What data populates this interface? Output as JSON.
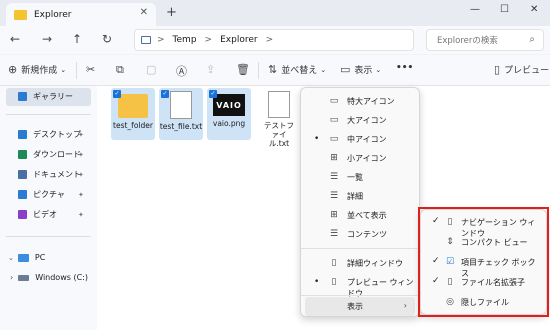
{
  "window": {
    "tab_title": "Explorer",
    "tab_close": "✕",
    "new_tab": "+",
    "minimize": "—",
    "maximize": "☐",
    "close": "✕"
  },
  "nav": {
    "back": "←",
    "forward": "→",
    "up": "↑",
    "refresh": "↻",
    "breadcrumb": [
      "Temp",
      "Explorer"
    ],
    "separator": ">",
    "search_placeholder": "Explorerの検索"
  },
  "toolbar": {
    "new": "新規作成",
    "sort": "並べ替え",
    "view": "表示",
    "more": "•••",
    "preview": "プレビュー"
  },
  "sidebar": {
    "gallery": "ギャラリー",
    "items": [
      {
        "label": "デスクトップ",
        "icon": "desktop-icon",
        "color": "#2a7bd4"
      },
      {
        "label": "ダウンロード",
        "icon": "download-icon",
        "color": "#1e8a55"
      },
      {
        "label": "ドキュメント",
        "icon": "document-icon",
        "color": "#4a6fa5"
      },
      {
        "label": "ピクチャ",
        "icon": "pictures-icon",
        "color": "#2a7bd4"
      },
      {
        "label": "ビデオ",
        "icon": "videos-icon",
        "color": "#8b3fc9"
      }
    ],
    "pc": "PC",
    "drive": "Windows (C:)"
  },
  "files": [
    {
      "name": "test_folder",
      "type": "folder",
      "selected": true
    },
    {
      "name": "test_file.txt",
      "type": "text",
      "selected": true
    },
    {
      "name": "vaio.png",
      "type": "image",
      "selected": true,
      "thumb_text": "VAIO"
    },
    {
      "name": "テストファイル.txt",
      "type": "text",
      "selected": false
    }
  ],
  "view_menu": {
    "items": [
      {
        "label": "特大アイコン",
        "icon": "▭",
        "dot": false
      },
      {
        "label": "大アイコン",
        "icon": "▭",
        "dot": false
      },
      {
        "label": "中アイコン",
        "icon": "▭",
        "dot": true
      },
      {
        "label": "小アイコン",
        "icon": "⊞",
        "dot": false
      },
      {
        "label": "一覧",
        "icon": "☰",
        "dot": false
      },
      {
        "label": "詳細",
        "icon": "☰",
        "dot": false
      },
      {
        "label": "並べて表示",
        "icon": "⊞",
        "dot": false
      },
      {
        "label": "コンテンツ",
        "icon": "☰",
        "dot": false
      },
      {
        "label": "詳細ウィンドウ",
        "icon": "▯",
        "dot": false
      },
      {
        "label": "プレビュー ウィンドウ",
        "icon": "▯",
        "dot": true
      },
      {
        "label": "表示",
        "icon": "",
        "dot": false,
        "submenu": true
      }
    ]
  },
  "show_submenu": {
    "items": [
      {
        "label": "ナビゲーション ウィンドウ",
        "icon": "▯",
        "checked": true
      },
      {
        "label": "コンパクト ビュー",
        "icon": "⇕",
        "checked": false
      },
      {
        "label": "項目チェック ボックス",
        "icon": "☑",
        "checked": true
      },
      {
        "label": "ファイル名拡張子",
        "icon": "▯",
        "checked": true
      },
      {
        "label": "隠しファイル",
        "icon": "◎",
        "checked": false
      }
    ]
  }
}
